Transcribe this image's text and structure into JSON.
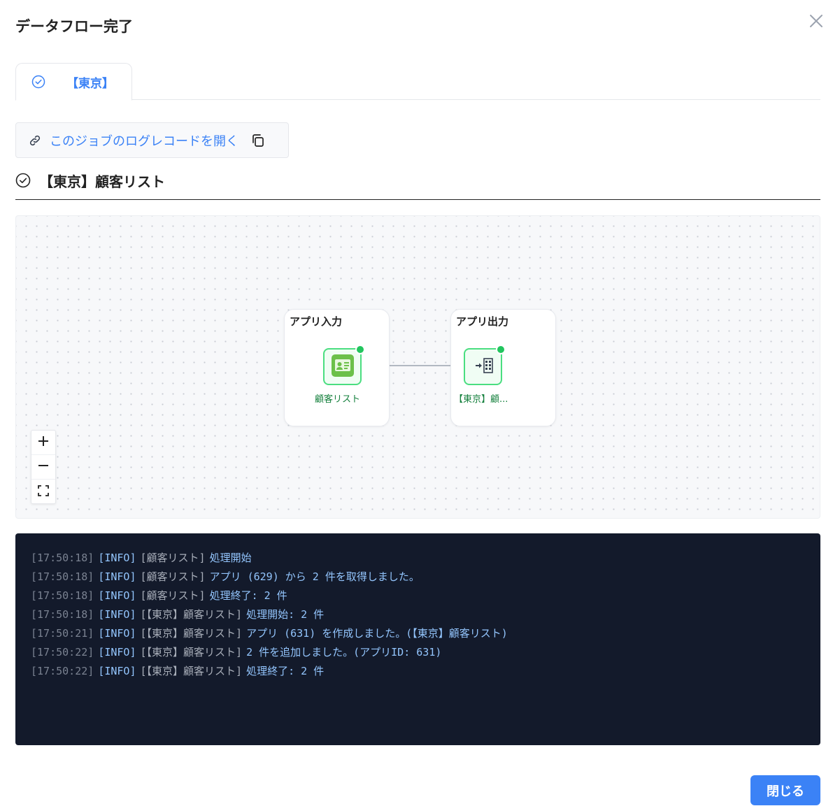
{
  "dialog": {
    "title": "データフロー完了",
    "close_icon": "close-icon"
  },
  "tabs": [
    {
      "label": "【東京】",
      "icon": "check-circle-icon",
      "active": true
    }
  ],
  "log_link": {
    "label": "このジョブのログレコードを開く",
    "icon": "link-icon",
    "copy_icon": "copy-icon"
  },
  "section": {
    "title": "【東京】顧客リスト",
    "icon": "check-circle-icon"
  },
  "flow": {
    "groups": [
      {
        "title": "アプリ入力",
        "node_label": "顧客リスト",
        "node_icon": "app-contact-card-icon",
        "status": "done"
      },
      {
        "title": "アプリ出力",
        "node_label": "【東京】顧...",
        "node_icon": "app-output-grid-icon",
        "status": "done"
      }
    ],
    "zoom_controls": [
      "zoom-in",
      "zoom-out",
      "fit-view"
    ]
  },
  "logs": [
    {
      "time": "[17:50:18]",
      "level": "[INFO]",
      "source": "[顧客リスト]",
      "message": "処理開始"
    },
    {
      "time": "[17:50:18]",
      "level": "[INFO]",
      "source": "[顧客リスト]",
      "message": "アプリ (629) から 2 件を取得しました。"
    },
    {
      "time": "[17:50:18]",
      "level": "[INFO]",
      "source": "[顧客リスト]",
      "message": "処理終了: 2 件"
    },
    {
      "time": "[17:50:18]",
      "level": "[INFO]",
      "source": "[【東京】顧客リスト]",
      "message": "処理開始: 2 件"
    },
    {
      "time": "[17:50:21]",
      "level": "[INFO]",
      "source": "[【東京】顧客リスト]",
      "message": "アプリ (631) を作成しました。(【東京】顧客リスト)"
    },
    {
      "time": "[17:50:22]",
      "level": "[INFO]",
      "source": "[【東京】顧客リスト]",
      "message": "2 件を追加しました。(アプリID: 631)"
    },
    {
      "time": "[17:50:22]",
      "level": "[INFO]",
      "source": "[【東京】顧客リスト]",
      "message": "処理終了: 2 件"
    }
  ],
  "footer": {
    "close_label": "閉じる"
  },
  "colors": {
    "accent": "#3b82f6",
    "success": "#22c55e",
    "console_bg": "#131a2b"
  }
}
